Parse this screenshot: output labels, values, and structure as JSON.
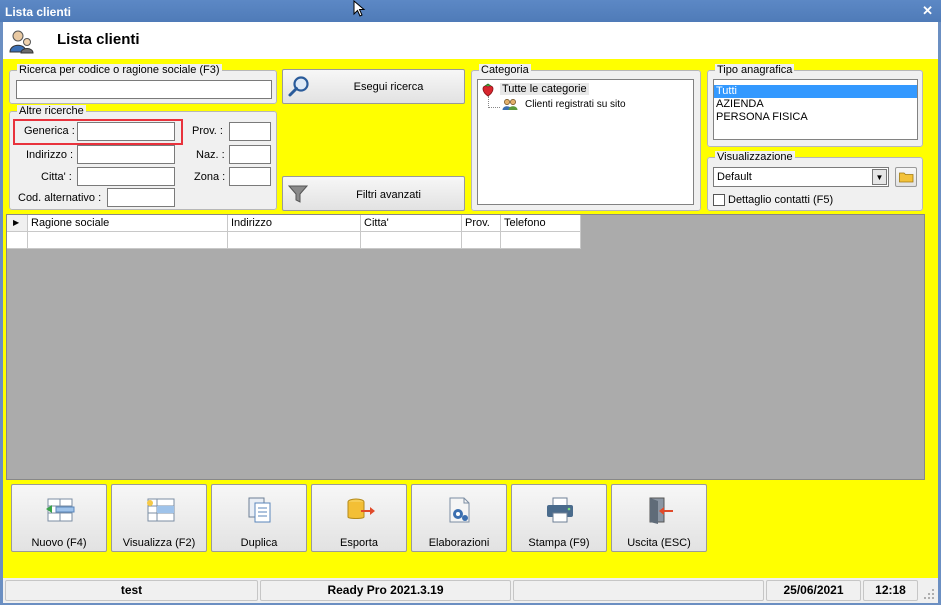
{
  "window": {
    "title": "Lista clienti",
    "close_glyph": "✕"
  },
  "header": {
    "title": "Lista clienti",
    "icon": "users-icon"
  },
  "search_code": {
    "legend": "Ricerca per codice o ragione sociale (F3)",
    "value": ""
  },
  "other_searches": {
    "legend": "Altre ricerche",
    "generica_label": "Generica :",
    "indirizzo_label": "Indirizzo :",
    "citta_label": "Citta' :",
    "cod_alt_label": "Cod. alternativo :",
    "prov_label": "Prov. :",
    "naz_label": "Naz. :",
    "zona_label": "Zona :"
  },
  "buttons": {
    "search": "Esegui ricerca",
    "filters": "Filtri avanzati"
  },
  "categoria": {
    "legend": "Categoria",
    "root": "Tutte le categorie",
    "child": "Clienti registrati su sito"
  },
  "tipo_anagrafica": {
    "legend": "Tipo anagrafica",
    "options": [
      "Tutti",
      "AZIENDA",
      "PERSONA FISICA"
    ],
    "selected": "Tutti"
  },
  "visualizzazione": {
    "legend": "Visualizzazione",
    "selected": "Default",
    "checkbox_label": "Dettaglio contatti (F5)",
    "checked": false
  },
  "grid": {
    "columns": [
      "Ragione sociale",
      "Indirizzo",
      "Citta'",
      "Prov.",
      "Telefono"
    ]
  },
  "toolbar": [
    {
      "label": "Nuovo (F4)",
      "icon": "new-record-icon"
    },
    {
      "label": "Visualizza (F2)",
      "icon": "view-record-icon"
    },
    {
      "label": "Duplica",
      "icon": "duplicate-icon"
    },
    {
      "label": "Esporta",
      "icon": "export-icon"
    },
    {
      "label": "Elaborazioni",
      "icon": "process-icon"
    },
    {
      "label": "Stampa (F9)",
      "icon": "printer-icon"
    },
    {
      "label": "Uscita (ESC)",
      "icon": "exit-icon"
    }
  ],
  "status": {
    "user": "test",
    "app": "Ready Pro 2021.3.19",
    "date": "25/06/2021",
    "time": "12:18"
  },
  "colors": {
    "background": "#ffff00",
    "titlebar": "#5c88c5",
    "highlight": "#e8323c",
    "selection": "#3399ff"
  }
}
